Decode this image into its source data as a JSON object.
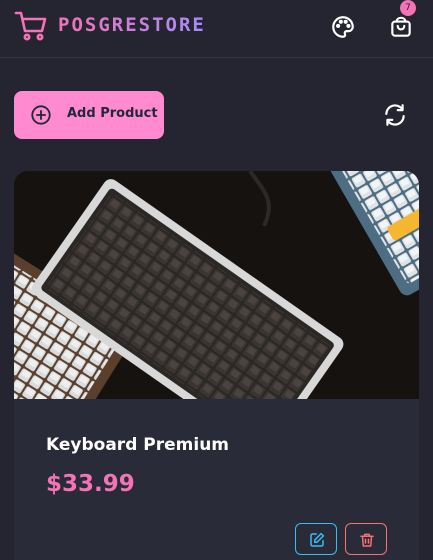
{
  "navbar": {
    "brand": "POSGRESTORE",
    "cart_count": "7"
  },
  "toolbar": {
    "add_product_label": "Add Product"
  },
  "products": [
    {
      "title": "Keyboard Premium",
      "price": "$33.99",
      "image_icon": "keyboard-photo"
    }
  ],
  "colors": {
    "background": "#242531",
    "accent_pink": "#f472b6",
    "button_pink": "#ff8ad0",
    "accent_purple": "#a78bfa",
    "edit_blue": "#38bdf8",
    "delete_red": "#f87171"
  },
  "icons": {
    "logo": "shopping-cart-icon",
    "theme": "palette-icon",
    "cart": "shopping-bag-icon",
    "add": "plus-circle-icon",
    "refresh": "refresh-icon",
    "edit": "edit-icon",
    "delete": "trash-icon"
  }
}
